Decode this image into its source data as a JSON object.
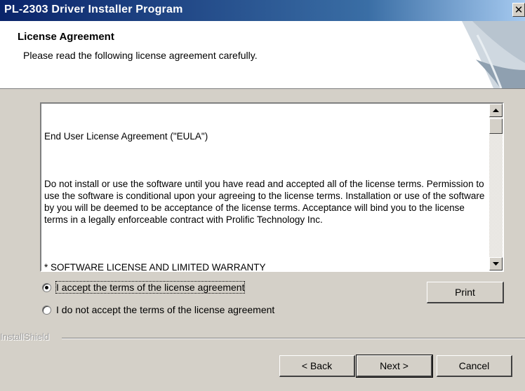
{
  "window": {
    "title": "PL-2303 Driver Installer Program",
    "close_glyph": "✕"
  },
  "header": {
    "title": "License Agreement",
    "subtitle": "Please read the following license agreement carefully."
  },
  "license": {
    "paragraphs": [
      "End User License Agreement (\"EULA\")",
      "Do not install or use the software until you have read and accepted all of the license terms. Permission to use the software is conditional upon your agreeing to the license terms. Installation or use of the software by you will be deemed to be acceptance of the license terms. Acceptance will bind you to the license terms in a legally enforceable contract with Prolific Technology Inc.",
      "* SOFTWARE LICENSE AND LIMITED WARRANTY\nThis is an agreement between you, the end user, and Prolific Technology Inc. (\"Prolific\"). By using this software, you agree to become bound by the terms of this agreement."
    ]
  },
  "options": {
    "accept_label": "I accept the terms of the license agreement",
    "decline_label": "I do not accept the terms of the license agreement",
    "selected": "accept"
  },
  "buttons": {
    "print": "Print",
    "back": "< Back",
    "next": "Next >",
    "cancel": "Cancel"
  },
  "footer": {
    "brand": "InstallShield"
  }
}
